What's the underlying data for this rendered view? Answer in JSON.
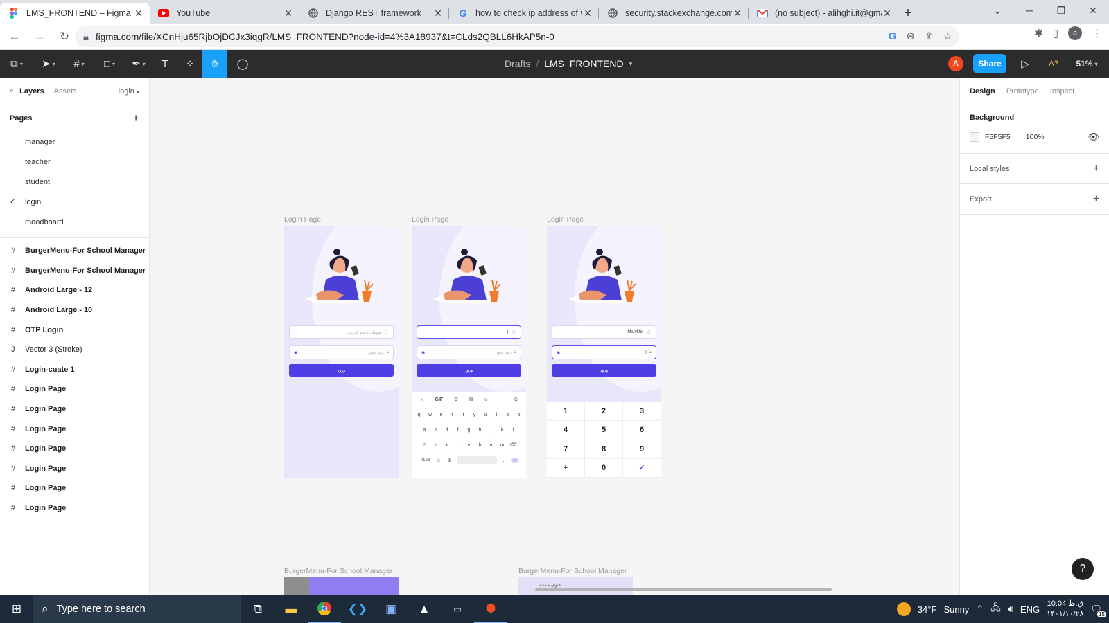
{
  "browser": {
    "tabs": [
      {
        "title": "LMS_FRONTEND – Figma",
        "icon": "figma-icon",
        "active": true
      },
      {
        "title": "YouTube",
        "icon": "youtube-icon"
      },
      {
        "title": "Django REST framework",
        "icon": "globe-icon"
      },
      {
        "title": "how to check ip address of w",
        "icon": "google-icon"
      },
      {
        "title": "security.stackexchange.com",
        "icon": "globe-icon"
      },
      {
        "title": "(no subject) - alihghi.it@gmai",
        "icon": "gmail-icon"
      }
    ],
    "url": "figma.com/file/XCnHju65RjbOjDCJx3iqgR/LMS_FRONTEND?node-id=4%3A18937&t=CLds2QBLL6HkAP5n-0",
    "profile_initial": "a"
  },
  "figma": {
    "breadcrumb_drafts": "Drafts",
    "breadcrumb_sep": "/",
    "file_name": "LMS_FRONTEND",
    "user_initial": "A",
    "share_label": "Share",
    "zoom": "51%"
  },
  "left_panel": {
    "tab_layers": "Layers",
    "tab_assets": "Assets",
    "current_page": "login",
    "pages_header": "Pages",
    "pages": [
      "manager",
      "teacher",
      "student",
      "login",
      "moodboard"
    ],
    "layers": [
      {
        "icon": "#",
        "name": "BurgerMenu-For School Manager"
      },
      {
        "icon": "#",
        "name": "BurgerMenu-For School Manager"
      },
      {
        "icon": "#",
        "name": "Android Large - 12"
      },
      {
        "icon": "#",
        "name": "Android Large - 10"
      },
      {
        "icon": "#",
        "name": "OTP Login"
      },
      {
        "icon": "J",
        "name": "Vector 3 (Stroke)"
      },
      {
        "icon": "#",
        "name": "Login-cuate 1"
      },
      {
        "icon": "#",
        "name": "Login Page"
      },
      {
        "icon": "#",
        "name": "Login Page"
      },
      {
        "icon": "#",
        "name": "Login Page"
      },
      {
        "icon": "#",
        "name": "Login Page"
      },
      {
        "icon": "#",
        "name": "Login Page"
      },
      {
        "icon": "#",
        "name": "Login Page"
      },
      {
        "icon": "#",
        "name": "Login Page"
      }
    ]
  },
  "canvas": {
    "frame_labels": [
      "Login Page",
      "Login Page",
      "Login Page"
    ],
    "bottom_labels": [
      "BurgerMenu-For School Manager",
      "BurgerMenu-For School Manager"
    ],
    "username_placeholder": "موبایل یا نام کاربری",
    "password_placeholder": "رمز عبور",
    "login_label": "ورود",
    "filled_username": "MaryMio",
    "keyboard_top": [
      "GIF"
    ],
    "keyboard_rows": [
      [
        "q",
        "w",
        "e",
        "r",
        "t",
        "y",
        "u",
        "i",
        "o",
        "p"
      ],
      [
        "a",
        "s",
        "d",
        "f",
        "g",
        "h",
        "j",
        "k",
        "l"
      ],
      [
        "z",
        "x",
        "c",
        "v",
        "b",
        "n",
        "m"
      ]
    ],
    "keyboard_sym": "?123",
    "numpad": [
      "1",
      "2",
      "3",
      "4",
      "5",
      "6",
      "7",
      "8",
      "9",
      "+",
      "0",
      "✓"
    ],
    "bottom_mini_label": "عنوان صفحه"
  },
  "right_panel": {
    "tab_design": "Design",
    "tab_prototype": "Prototype",
    "tab_inspect": "Inspect",
    "background_header": "Background",
    "bg_hex": "F5F5F5",
    "bg_opacity": "100%",
    "local_styles": "Local styles",
    "export": "Export"
  },
  "taskbar": {
    "search_placeholder": "Type here to search",
    "weather_temp": "34°F",
    "weather_text": "Sunny",
    "lang": "ENG",
    "time": "10:04 ق.ظ",
    "date": "۱۴۰۱/۱۰/۲۸",
    "notif_count": "15"
  },
  "colors": {
    "accent": "#18a0fb",
    "frame_bg": "#e8e6fb",
    "login_button": "#4f3ee6",
    "canvas_bg": "#F5F5F5"
  }
}
